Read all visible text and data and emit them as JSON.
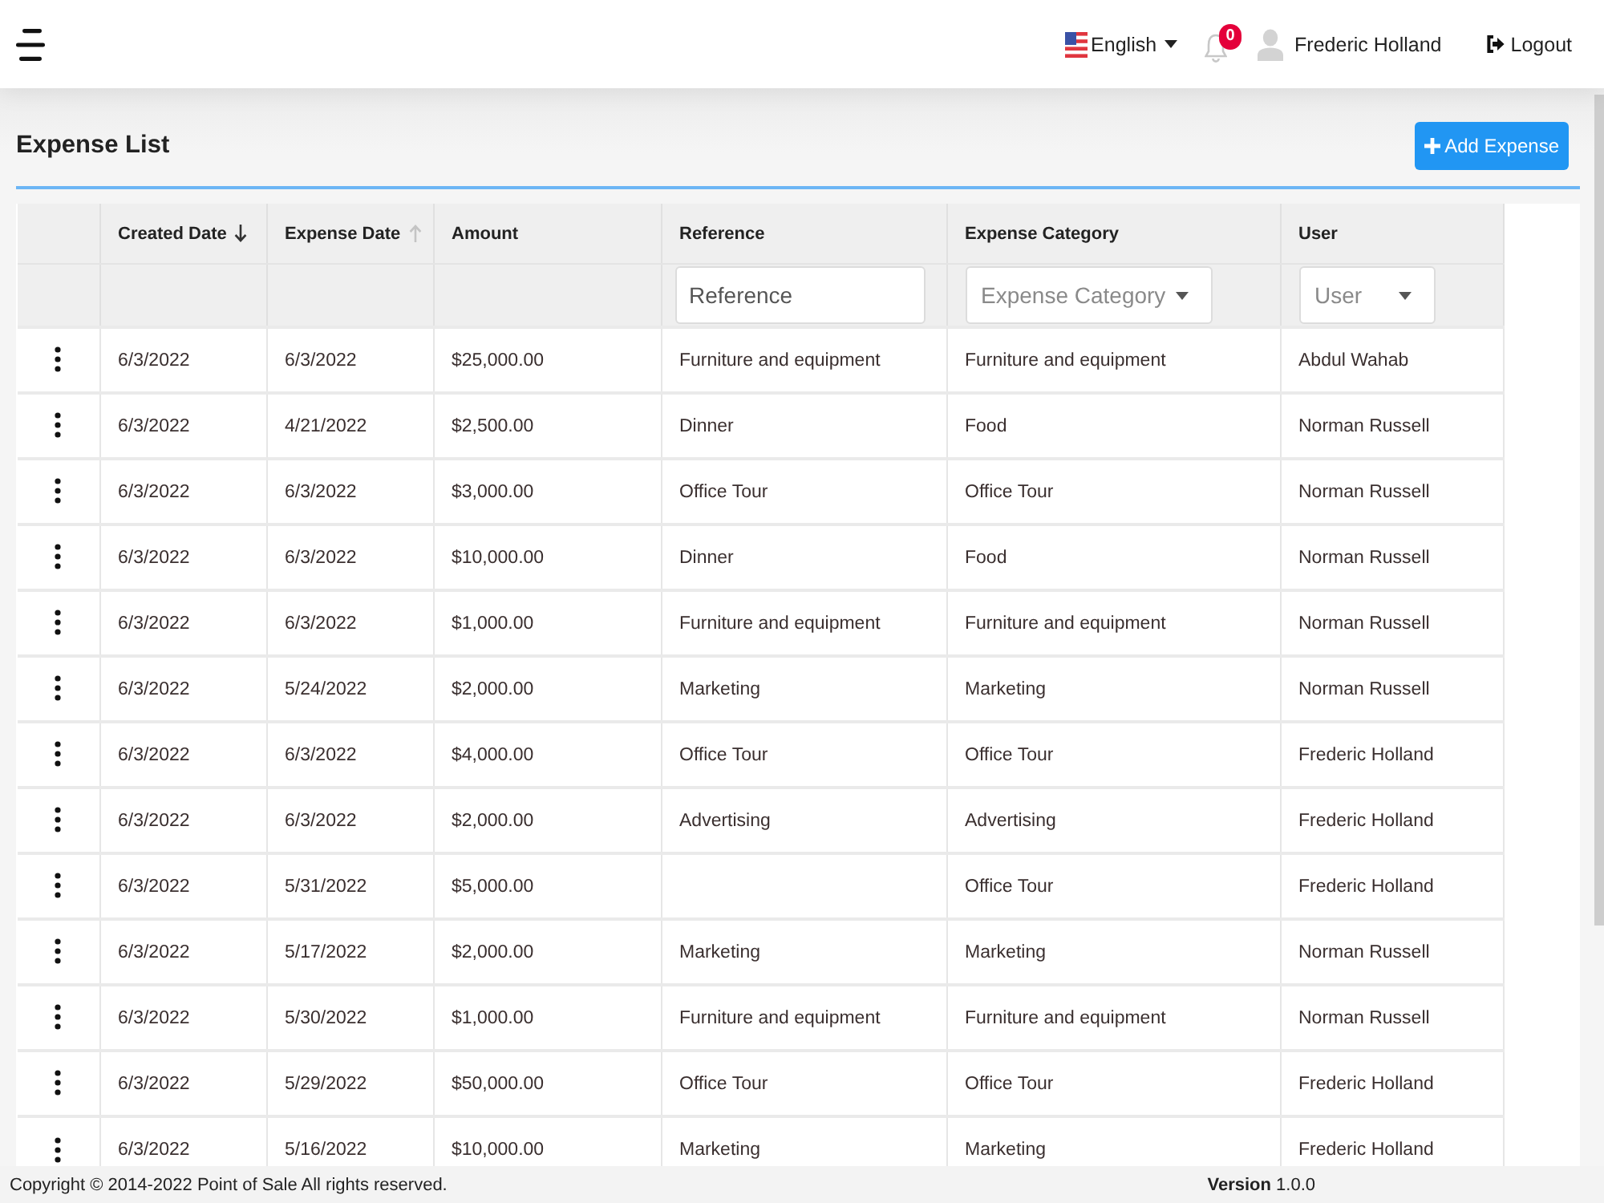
{
  "header": {
    "language": {
      "label": "English"
    },
    "notifications": {
      "count": "0"
    },
    "user": {
      "name": "Frederic Holland"
    },
    "logout": {
      "label": "Logout"
    }
  },
  "page": {
    "title": "Expense List",
    "add_button": {
      "label": "Add Expense"
    }
  },
  "table": {
    "columns": [
      {
        "label": "Created Date",
        "sortable": true,
        "sort_active": true,
        "descending": true
      },
      {
        "label": "Expense Date",
        "sortable": true,
        "sort_active": false,
        "descending": false
      },
      {
        "label": "Amount"
      },
      {
        "label": "Reference",
        "filter": {
          "kind": "text",
          "placeholder": "Reference"
        }
      },
      {
        "label": "Expense Category",
        "filter": {
          "kind": "select",
          "placeholder": "Expense Category"
        }
      },
      {
        "label": "User",
        "filter": {
          "kind": "select",
          "placeholder": "User"
        }
      }
    ],
    "rows": [
      {
        "created_date": "6/3/2022",
        "expense_date": "6/3/2022",
        "amount": "$25,000.00",
        "reference": "Furniture and equipment",
        "expense_category": "Furniture and equipment",
        "user": "Abdul Wahab"
      },
      {
        "created_date": "6/3/2022",
        "expense_date": "4/21/2022",
        "amount": "$2,500.00",
        "reference": "Dinner",
        "expense_category": "Food",
        "user": "Norman Russell"
      },
      {
        "created_date": "6/3/2022",
        "expense_date": "6/3/2022",
        "amount": "$3,000.00",
        "reference": "Office Tour",
        "expense_category": "Office Tour",
        "user": "Norman Russell"
      },
      {
        "created_date": "6/3/2022",
        "expense_date": "6/3/2022",
        "amount": "$10,000.00",
        "reference": "Dinner",
        "expense_category": "Food",
        "user": "Norman Russell"
      },
      {
        "created_date": "6/3/2022",
        "expense_date": "6/3/2022",
        "amount": "$1,000.00",
        "reference": "Furniture and equipment",
        "expense_category": "Furniture and equipment",
        "user": "Norman Russell"
      },
      {
        "created_date": "6/3/2022",
        "expense_date": "5/24/2022",
        "amount": "$2,000.00",
        "reference": "Marketing",
        "expense_category": "Marketing",
        "user": "Norman Russell"
      },
      {
        "created_date": "6/3/2022",
        "expense_date": "6/3/2022",
        "amount": "$4,000.00",
        "reference": "Office Tour",
        "expense_category": "Office Tour",
        "user": "Frederic Holland"
      },
      {
        "created_date": "6/3/2022",
        "expense_date": "6/3/2022",
        "amount": "$2,000.00",
        "reference": "Advertising",
        "expense_category": "Advertising",
        "user": "Frederic Holland"
      },
      {
        "created_date": "6/3/2022",
        "expense_date": "5/31/2022",
        "amount": "$5,000.00",
        "expense_category": "Office Tour",
        "user": "Frederic Holland"
      },
      {
        "created_date": "6/3/2022",
        "expense_date": "5/17/2022",
        "amount": "$2,000.00",
        "reference": "Marketing",
        "expense_category": "Marketing",
        "user": "Norman Russell"
      },
      {
        "created_date": "6/3/2022",
        "expense_date": "5/30/2022",
        "amount": "$1,000.00",
        "reference": "Furniture and equipment",
        "expense_category": "Furniture and equipment",
        "user": "Norman Russell"
      },
      {
        "created_date": "6/3/2022",
        "expense_date": "5/29/2022",
        "amount": "$50,000.00",
        "reference": "Office Tour",
        "expense_category": "Office Tour",
        "user": "Frederic Holland"
      },
      {
        "created_date": "6/3/2022",
        "expense_date": "5/16/2022",
        "amount": "$10,000.00",
        "reference": "Marketing",
        "expense_category": "Marketing",
        "user": "Frederic Holland"
      }
    ]
  },
  "footer": {
    "copyright": "Copyright © 2014-2022 Point of Sale All rights reserved.",
    "version": "**Version** 1.0.0"
  }
}
